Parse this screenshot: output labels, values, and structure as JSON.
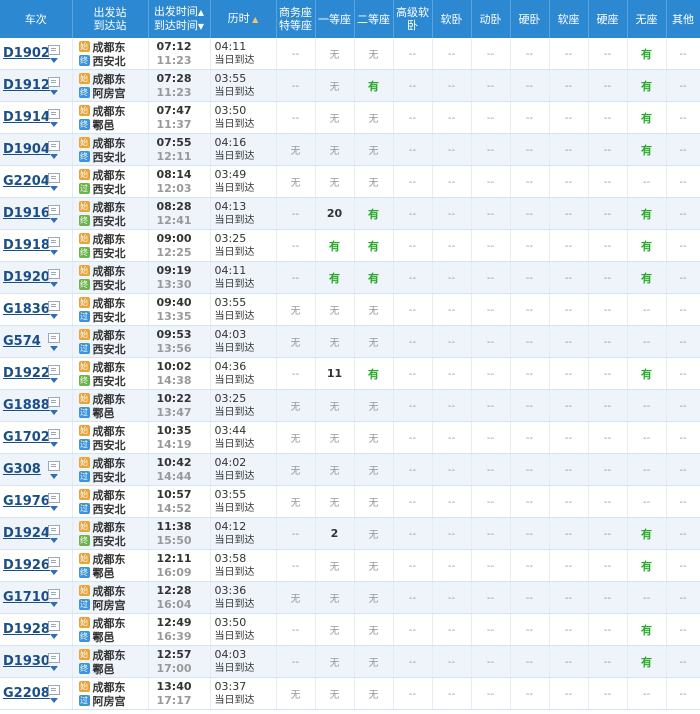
{
  "headers": {
    "train": "车次",
    "station_dep": "出发站",
    "station_arr": "到达站",
    "time_dep": "出发时间",
    "time_arr": "到达时间",
    "duration": "历时",
    "seat_classes": [
      "商务座特等座",
      "一等座",
      "二等座",
      "高级软卧",
      "软卧",
      "动卧",
      "硬卧",
      "软座",
      "硬座",
      "无座",
      "其他"
    ]
  },
  "colors": {
    "header_bg": "#2c88d0",
    "train_link": "#1a4e86",
    "available": "#26a926",
    "alt_row": "#eef4fa"
  },
  "trains": [
    {
      "no": "D1902",
      "from": "成都东",
      "to": "西安北",
      "from_badge": "始",
      "to_badge": "终",
      "to_badge_type": "end",
      "dep": "07:12",
      "arr": "11:23",
      "dur": "04:11",
      "day": "当日到达",
      "seats": [
        "--",
        "无",
        "无",
        "--",
        "--",
        "--",
        "--",
        "--",
        "--",
        "有",
        "--"
      ]
    },
    {
      "no": "D1912",
      "from": "成都东",
      "to": "阿房宫",
      "from_badge": "始",
      "to_badge": "终",
      "to_badge_type": "end",
      "dep": "07:28",
      "arr": "11:23",
      "dur": "03:55",
      "day": "当日到达",
      "seats": [
        "--",
        "无",
        "有",
        "--",
        "--",
        "--",
        "--",
        "--",
        "--",
        "有",
        "--"
      ]
    },
    {
      "no": "D1914",
      "from": "成都东",
      "to": "鄠邑",
      "from_badge": "始",
      "to_badge": "终",
      "to_badge_type": "end",
      "dep": "07:47",
      "arr": "11:37",
      "dur": "03:50",
      "day": "当日到达",
      "seats": [
        "--",
        "无",
        "无",
        "--",
        "--",
        "--",
        "--",
        "--",
        "--",
        "有",
        "--"
      ]
    },
    {
      "no": "D1904",
      "from": "成都东",
      "to": "西安北",
      "from_badge": "始",
      "to_badge": "终",
      "to_badge_type": "end",
      "dep": "07:55",
      "arr": "12:11",
      "dur": "04:16",
      "day": "当日到达",
      "seats": [
        "无",
        "无",
        "无",
        "--",
        "--",
        "--",
        "--",
        "--",
        "--",
        "有",
        "--"
      ]
    },
    {
      "no": "G2204",
      "from": "成都东",
      "to": "西安北",
      "from_badge": "始",
      "to_badge": "过",
      "to_badge_type": "pass",
      "dep": "08:14",
      "arr": "12:03",
      "dur": "03:49",
      "day": "当日到达",
      "seats": [
        "无",
        "无",
        "无",
        "--",
        "--",
        "--",
        "--",
        "--",
        "--",
        "--",
        "--"
      ]
    },
    {
      "no": "D1916",
      "from": "成都东",
      "to": "西安北",
      "from_badge": "始",
      "to_badge": "终",
      "to_badge_type": "pass",
      "dep": "08:28",
      "arr": "12:41",
      "dur": "04:13",
      "day": "当日到达",
      "seats": [
        "--",
        "20",
        "有",
        "--",
        "--",
        "--",
        "--",
        "--",
        "--",
        "有",
        "--"
      ]
    },
    {
      "no": "D1918",
      "from": "成都东",
      "to": "西安北",
      "from_badge": "始",
      "to_badge": "终",
      "to_badge_type": "pass",
      "dep": "09:00",
      "arr": "12:25",
      "dur": "03:25",
      "day": "当日到达",
      "seats": [
        "--",
        "有",
        "有",
        "--",
        "--",
        "--",
        "--",
        "--",
        "--",
        "有",
        "--"
      ]
    },
    {
      "no": "D1920",
      "from": "成都东",
      "to": "西安北",
      "from_badge": "始",
      "to_badge": "终",
      "to_badge_type": "pass",
      "dep": "09:19",
      "arr": "13:30",
      "dur": "04:11",
      "day": "当日到达",
      "seats": [
        "--",
        "有",
        "有",
        "--",
        "--",
        "--",
        "--",
        "--",
        "--",
        "有",
        "--"
      ]
    },
    {
      "no": "G1836",
      "from": "成都东",
      "to": "西安北",
      "from_badge": "始",
      "to_badge": "过",
      "to_badge_type": "end",
      "dep": "09:40",
      "arr": "13:35",
      "dur": "03:55",
      "day": "当日到达",
      "seats": [
        "无",
        "无",
        "无",
        "--",
        "--",
        "--",
        "--",
        "--",
        "--",
        "--",
        "--"
      ]
    },
    {
      "no": "G574",
      "from": "成都东",
      "to": "西安北",
      "from_badge": "始",
      "to_badge": "过",
      "to_badge_type": "end",
      "dep": "09:53",
      "arr": "13:56",
      "dur": "04:03",
      "day": "当日到达",
      "seats": [
        "无",
        "无",
        "无",
        "--",
        "--",
        "--",
        "--",
        "--",
        "--",
        "--",
        "--"
      ]
    },
    {
      "no": "D1922",
      "from": "成都东",
      "to": "西安北",
      "from_badge": "始",
      "to_badge": "终",
      "to_badge_type": "pass",
      "dep": "10:02",
      "arr": "14:38",
      "dur": "04:36",
      "day": "当日到达",
      "seats": [
        "--",
        "11",
        "有",
        "--",
        "--",
        "--",
        "--",
        "--",
        "--",
        "有",
        "--"
      ]
    },
    {
      "no": "G1888",
      "from": "成都东",
      "to": "鄠邑",
      "from_badge": "始",
      "to_badge": "过",
      "to_badge_type": "end",
      "dep": "10:22",
      "arr": "13:47",
      "dur": "03:25",
      "day": "当日到达",
      "seats": [
        "无",
        "无",
        "无",
        "--",
        "--",
        "--",
        "--",
        "--",
        "--",
        "--",
        "--"
      ]
    },
    {
      "no": "G1702",
      "from": "成都东",
      "to": "西安北",
      "from_badge": "始",
      "to_badge": "过",
      "to_badge_type": "end",
      "dep": "10:35",
      "arr": "14:19",
      "dur": "03:44",
      "day": "当日到达",
      "seats": [
        "无",
        "无",
        "无",
        "--",
        "--",
        "--",
        "--",
        "--",
        "--",
        "--",
        "--"
      ]
    },
    {
      "no": "G308",
      "from": "成都东",
      "to": "西安北",
      "from_badge": "始",
      "to_badge": "过",
      "to_badge_type": "end",
      "dep": "10:42",
      "arr": "14:44",
      "dur": "04:02",
      "day": "当日到达",
      "seats": [
        "无",
        "无",
        "无",
        "--",
        "--",
        "--",
        "--",
        "--",
        "--",
        "--",
        "--"
      ]
    },
    {
      "no": "G1976",
      "from": "成都东",
      "to": "西安北",
      "from_badge": "始",
      "to_badge": "过",
      "to_badge_type": "end",
      "dep": "10:57",
      "arr": "14:52",
      "dur": "03:55",
      "day": "当日到达",
      "seats": [
        "无",
        "无",
        "无",
        "--",
        "--",
        "--",
        "--",
        "--",
        "--",
        "--",
        "--"
      ]
    },
    {
      "no": "D1924",
      "from": "成都东",
      "to": "西安北",
      "from_badge": "始",
      "to_badge": "终",
      "to_badge_type": "pass",
      "dep": "11:38",
      "arr": "15:50",
      "dur": "04:12",
      "day": "当日到达",
      "seats": [
        "--",
        "2",
        "无",
        "--",
        "--",
        "--",
        "--",
        "--",
        "--",
        "有",
        "--"
      ]
    },
    {
      "no": "D1926",
      "from": "成都东",
      "to": "鄠邑",
      "from_badge": "始",
      "to_badge": "终",
      "to_badge_type": "end",
      "dep": "12:11",
      "arr": "16:09",
      "dur": "03:58",
      "day": "当日到达",
      "seats": [
        "--",
        "无",
        "无",
        "--",
        "--",
        "--",
        "--",
        "--",
        "--",
        "有",
        "--"
      ]
    },
    {
      "no": "G1710",
      "from": "成都东",
      "to": "阿房宫",
      "from_badge": "始",
      "to_badge": "过",
      "to_badge_type": "end",
      "dep": "12:28",
      "arr": "16:04",
      "dur": "03:36",
      "day": "当日到达",
      "seats": [
        "无",
        "无",
        "无",
        "--",
        "--",
        "--",
        "--",
        "--",
        "--",
        "--",
        "--"
      ]
    },
    {
      "no": "D1928",
      "from": "成都东",
      "to": "鄠邑",
      "from_badge": "始",
      "to_badge": "终",
      "to_badge_type": "end",
      "dep": "12:49",
      "arr": "16:39",
      "dur": "03:50",
      "day": "当日到达",
      "seats": [
        "--",
        "无",
        "无",
        "--",
        "--",
        "--",
        "--",
        "--",
        "--",
        "有",
        "--"
      ]
    },
    {
      "no": "D1930",
      "from": "成都东",
      "to": "鄠邑",
      "from_badge": "始",
      "to_badge": "终",
      "to_badge_type": "end",
      "dep": "12:57",
      "arr": "17:00",
      "dur": "04:03",
      "day": "当日到达",
      "seats": [
        "--",
        "无",
        "无",
        "--",
        "--",
        "--",
        "--",
        "--",
        "--",
        "有",
        "--"
      ]
    },
    {
      "no": "G2208",
      "from": "成都东",
      "to": "阿房宫",
      "from_badge": "始",
      "to_badge": "过",
      "to_badge_type": "end",
      "dep": "13:40",
      "arr": "17:17",
      "dur": "03:37",
      "day": "当日到达",
      "seats": [
        "无",
        "无",
        "无",
        "--",
        "--",
        "--",
        "--",
        "--",
        "--",
        "--",
        "--"
      ]
    }
  ]
}
